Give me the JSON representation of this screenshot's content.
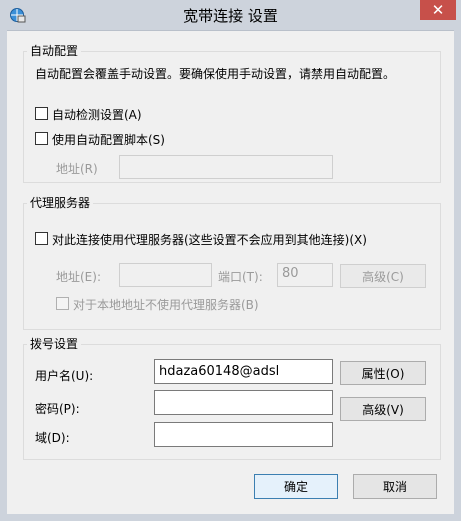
{
  "window": {
    "title": "宽带连接 设置",
    "close_glyph": "✕"
  },
  "auto_config": {
    "legend": "自动配置",
    "description": "自动配置会覆盖手动设置。要确保使用手动设置，请禁用自动配置。",
    "auto_detect_label": "自动检测设置(A)",
    "auto_script_label": "使用自动配置脚本(S)",
    "address_label": "地址(R)",
    "address_value": ""
  },
  "proxy": {
    "legend": "代理服务器",
    "use_proxy_label": "对此连接使用代理服务器(这些设置不会应用到其他连接)(X)",
    "address_label": "地址(E):",
    "address_value": "",
    "port_label": "端口(T):",
    "port_value": "80",
    "advanced_label": "高级(C)",
    "bypass_local_label": "对于本地地址不使用代理服务器(B)"
  },
  "dialup": {
    "legend": "拨号设置",
    "username_label": "用户名(U):",
    "username_value": "hdaza60148@adsl",
    "properties_label": "属性(O)",
    "password_label": "密码(P):",
    "password_value": "",
    "advanced_label": "高级(V)",
    "domain_label": "域(D):",
    "domain_value": ""
  },
  "footer": {
    "ok_label": "确定",
    "cancel_label": "取消"
  },
  "colors": {
    "close_button": "#c7504a",
    "titlebar": "#cdd3dc",
    "dialog_bg": "#f0f0f0",
    "default_button_border": "#3c7fb1"
  }
}
